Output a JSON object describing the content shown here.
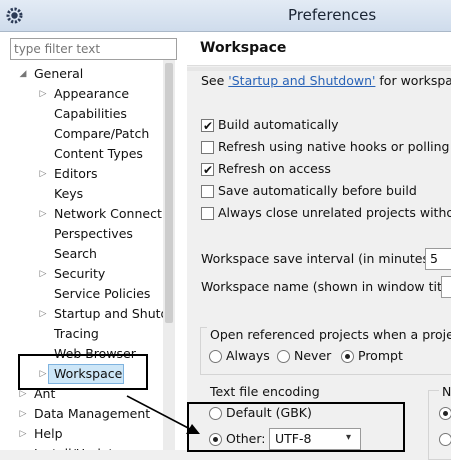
{
  "window": {
    "title": "Preferences",
    "app_icon": "eclipse-gear-icon"
  },
  "left": {
    "filter_placeholder": "type filter text",
    "tree": [
      {
        "label": "General",
        "level": 1,
        "arrow": "down"
      },
      {
        "label": "Appearance",
        "level": 2,
        "arrow": "right"
      },
      {
        "label": "Capabilities",
        "level": 2,
        "arrow": ""
      },
      {
        "label": "Compare/Patch",
        "level": 2,
        "arrow": ""
      },
      {
        "label": "Content Types",
        "level": 2,
        "arrow": ""
      },
      {
        "label": "Editors",
        "level": 2,
        "arrow": "right"
      },
      {
        "label": "Keys",
        "level": 2,
        "arrow": ""
      },
      {
        "label": "Network Connectio",
        "level": 2,
        "arrow": "right"
      },
      {
        "label": "Perspectives",
        "level": 2,
        "arrow": ""
      },
      {
        "label": "Search",
        "level": 2,
        "arrow": ""
      },
      {
        "label": "Security",
        "level": 2,
        "arrow": "right"
      },
      {
        "label": "Service Policies",
        "level": 2,
        "arrow": ""
      },
      {
        "label": "Startup and Shutd",
        "level": 2,
        "arrow": "right"
      },
      {
        "label": "Tracing",
        "level": 2,
        "arrow": ""
      },
      {
        "label": "Web Browser",
        "level": 2,
        "arrow": ""
      },
      {
        "label": "Workspace",
        "level": 2,
        "arrow": "right",
        "selected": true
      },
      {
        "label": "Ant",
        "level": 1,
        "arrow": "right"
      },
      {
        "label": "Data Management",
        "level": 1,
        "arrow": "right"
      },
      {
        "label": "Help",
        "level": 1,
        "arrow": "right"
      },
      {
        "label": "Install/Update",
        "level": 1,
        "arrow": "right"
      }
    ]
  },
  "right": {
    "title": "Workspace",
    "see_prefix": "See ",
    "see_link": "'Startup and Shutdown'",
    "see_suffix": " for workspace",
    "checkboxes": [
      {
        "label": "Build automatically",
        "checked": true
      },
      {
        "label": "Refresh using native hooks or polling",
        "checked": false
      },
      {
        "label": "Refresh on access",
        "checked": true
      },
      {
        "label": "Save automatically before build",
        "checked": false
      },
      {
        "label": "Always close unrelated projects without",
        "checked": false
      }
    ],
    "save_interval_label": "Workspace save interval (in minutes):",
    "save_interval_value": "5",
    "name_label": "Workspace name (shown in window title):",
    "open_ref_label": "Open referenced projects when a project",
    "open_ref_options": [
      "Always",
      "Never",
      "Prompt"
    ],
    "open_ref_selected": "Prompt",
    "encoding_title": "Text file encoding",
    "encoding_default": "Default (GBK)",
    "encoding_other": "Other:",
    "encoding_value": "UTF-8",
    "encoding_selected": "Other",
    "right_group_title": "N"
  }
}
